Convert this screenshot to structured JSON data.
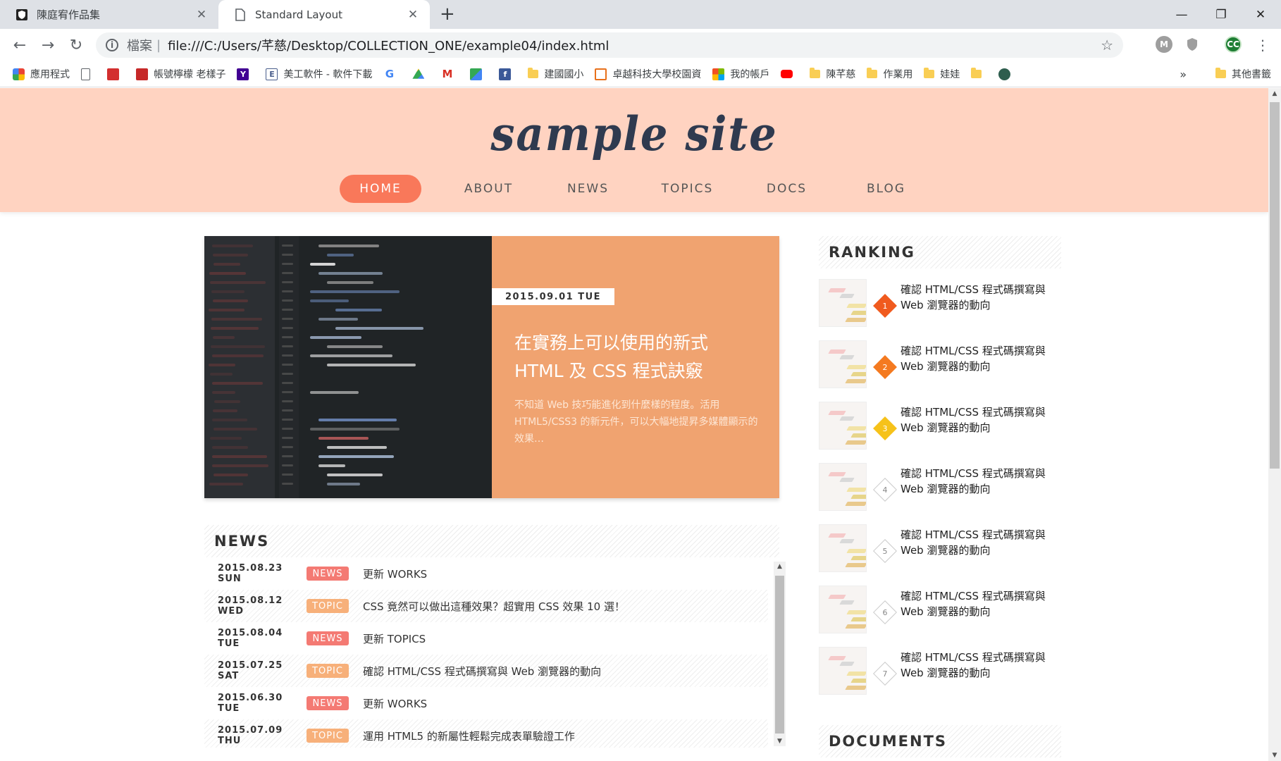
{
  "browser": {
    "tabs": [
      {
        "title": "陳庭宥作品集",
        "icon": "shield-favicon"
      },
      {
        "title": "Standard Layout",
        "icon": "page-favicon"
      }
    ],
    "url_scheme": "檔案",
    "url": "file:///C:/Users/芊慈/Desktop/COLLECTION_ONE/example04/index.html",
    "profile_initials": "CC",
    "extension_letter": "M",
    "bookmarks": [
      {
        "label": "應用程式",
        "icon": "apps-grid-icon"
      },
      {
        "label": "",
        "icon": "page-icon"
      },
      {
        "label": "",
        "icon": "red-heart-icon"
      },
      {
        "label": "帳號檸檬 老樣子",
        "icon": "red-logo-icon"
      },
      {
        "label": "",
        "icon": "yahoo-icon",
        "glyph": "Y"
      },
      {
        "label": "美工軟件 - 軟件下載",
        "icon": "e-icon",
        "glyph": "E"
      },
      {
        "label": "",
        "icon": "google-icon",
        "glyph": "G"
      },
      {
        "label": "",
        "icon": "drive-icon"
      },
      {
        "label": "",
        "icon": "gmail-icon",
        "glyph": "M"
      },
      {
        "label": "",
        "icon": "maps-icon"
      },
      {
        "label": "",
        "icon": "facebook-icon",
        "glyph": "f"
      },
      {
        "label": "建國國小",
        "icon": "folder-icon"
      },
      {
        "label": "卓越科技大學校園資",
        "icon": "orange-logo-icon"
      },
      {
        "label": "我的帳戶",
        "icon": "microsoft-icon"
      },
      {
        "label": "",
        "icon": "youtube-icon"
      },
      {
        "label": "陳芊慈",
        "icon": "folder-icon"
      },
      {
        "label": "作業用",
        "icon": "folder-icon"
      },
      {
        "label": "娃娃",
        "icon": "folder-icon"
      },
      {
        "label": "",
        "icon": "folder-icon"
      },
      {
        "label": "",
        "icon": "circle-logo-icon"
      }
    ],
    "bookmarks_more": "»",
    "other_bookmarks": "其他書籤"
  },
  "site": {
    "logo": "sample site",
    "nav": [
      "HOME",
      "ABOUT",
      "NEWS",
      "TOPICS",
      "DOCS",
      "BLOG"
    ],
    "active_nav": "HOME",
    "accent_color": "#f9785a",
    "header_color": "#ffd3c1"
  },
  "hero": {
    "date": "2015.09.01 TUE",
    "title": "在實務上可以使用的新式 HTML 及 CSS 程式訣竅",
    "description": "不知道 Web 技巧能進化到什麼樣的程度。活用 HTML5/CSS3 的新元件，可以大幅地提昇多媒體顯示的效果…"
  },
  "news": {
    "heading": "NEWS",
    "items": [
      {
        "date": "2015.08.23 SUN",
        "category": "NEWS",
        "text": "更新 WORKS"
      },
      {
        "date": "2015.08.12 WED",
        "category": "TOPIC",
        "text": "CSS 竟然可以做出這種效果？超實用 CSS 效果 10 選！"
      },
      {
        "date": "2015.08.04 TUE",
        "category": "NEWS",
        "text": "更新 TOPICS"
      },
      {
        "date": "2015.07.25 SAT",
        "category": "TOPIC",
        "text": "確認 HTML/CSS 程式碼撰寫與 Web 瀏覽器的動向"
      },
      {
        "date": "2015.06.30 TUE",
        "category": "NEWS",
        "text": "更新 WORKS"
      },
      {
        "date": "2015.07.09 THU",
        "category": "TOPIC",
        "text": "運用 HTML5 的新屬性輕鬆完成表單驗證工作"
      }
    ]
  },
  "ranking": {
    "heading": "RANKING",
    "items": [
      {
        "rank": "1",
        "line1": "確認 HTML/CSS 程式碼撰寫與",
        "line2": "Web 瀏覽器的動向",
        "color": "#f05a1e"
      },
      {
        "rank": "2",
        "line1": "確認 HTML/CSS 程式碼撰寫與",
        "line2": "Web 瀏覽器的動向",
        "color": "#f47a20"
      },
      {
        "rank": "3",
        "line1": "確認 HTML/CSS 程式碼撰寫與",
        "line2": "Web 瀏覽器的動向",
        "color": "#f6c21a"
      },
      {
        "rank": "4",
        "line1": "確認 HTML/CSS 程式碼撰寫與",
        "line2": "Web 瀏覽器的動向",
        "color": ""
      },
      {
        "rank": "5",
        "line1": "確認 HTML/CSS 程式碼撰寫與",
        "line2": "Web 瀏覽器的動向",
        "color": ""
      },
      {
        "rank": "6",
        "line1": "確認 HTML/CSS 程式碼撰寫與",
        "line2": "Web 瀏覽器的動向",
        "color": ""
      },
      {
        "rank": "7",
        "line1": "確認 HTML/CSS 程式碼撰寫與",
        "line2": "Web 瀏覽器的動向",
        "color": ""
      }
    ]
  },
  "documents": {
    "heading": "DOCUMENTS"
  }
}
